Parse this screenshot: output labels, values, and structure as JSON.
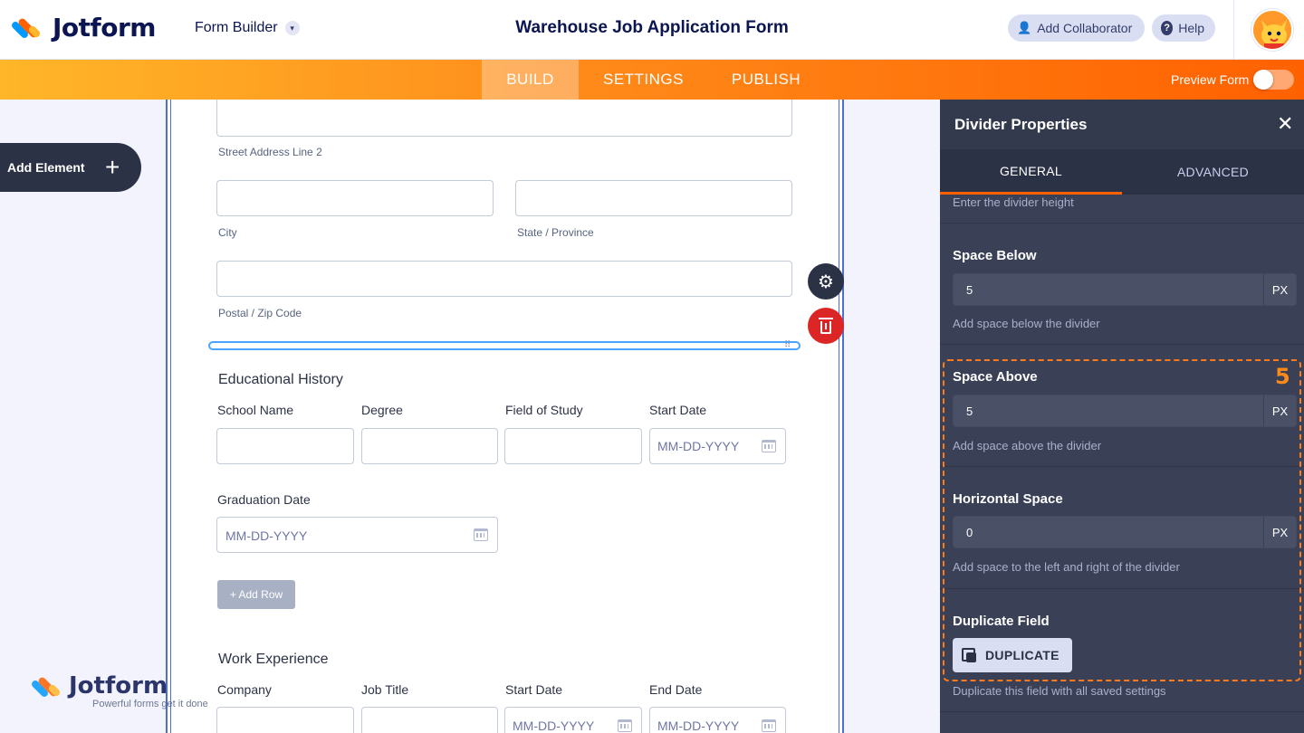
{
  "header": {
    "brand": "Jotform",
    "builder_menu": "Form Builder",
    "form_title": "Warehouse Job Application Form",
    "add_collaborator": "Add Collaborator",
    "help": "Help"
  },
  "nav": {
    "tabs": [
      "BUILD",
      "SETTINGS",
      "PUBLISH"
    ],
    "active": "BUILD",
    "preview_label": "Preview Form",
    "preview_on": false
  },
  "sidebar": {
    "add_element": "Add Element"
  },
  "form": {
    "address": {
      "street2_label": "Street Address Line 2",
      "city_label": "City",
      "state_label": "State / Province",
      "postal_label": "Postal / Zip Code"
    },
    "education": {
      "title": "Educational History",
      "columns": [
        "School Name",
        "Degree",
        "Field of Study",
        "Start Date"
      ],
      "date_placeholder": "MM-DD-YYYY",
      "graduation_label": "Graduation Date",
      "add_row": "+ Add Row"
    },
    "work": {
      "title": "Work Experience",
      "columns": [
        "Company",
        "Job Title",
        "Start Date",
        "End Date"
      ],
      "date_placeholder": "MM-DD-YYYY"
    }
  },
  "watermark": {
    "brand": "Jotform",
    "tagline": "Powerful forms get it done"
  },
  "panel": {
    "title": "Divider Properties",
    "tabs": [
      "GENERAL",
      "ADVANCED"
    ],
    "active_tab": "GENERAL",
    "height_desc": "Enter the divider height",
    "space_below": {
      "label": "Space Below",
      "value": "5",
      "unit": "PX",
      "desc": "Add space below the divider"
    },
    "space_above": {
      "label": "Space Above",
      "value": "5",
      "unit": "PX",
      "desc": "Add space above the divider"
    },
    "horizontal": {
      "label": "Horizontal Space",
      "value": "0",
      "unit": "PX",
      "desc": "Add space to the left and right of the divider"
    },
    "duplicate": {
      "label": "Duplicate Field",
      "button": "DUPLICATE",
      "desc": "Duplicate this field with all saved settings"
    },
    "step_badge": "5"
  },
  "colors": {
    "accent": "#ff6100",
    "navy": "#0a1551",
    "panel_bg": "#3a4055",
    "selection": "#4aa3ff"
  }
}
